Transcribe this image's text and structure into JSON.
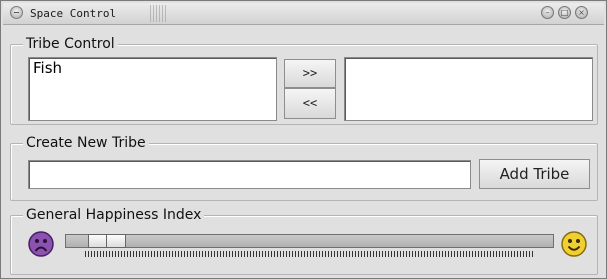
{
  "window": {
    "title": "Space Control"
  },
  "tribe_control": {
    "legend": "Tribe Control",
    "left_list": [
      "Fish"
    ],
    "right_list": [],
    "move_right_label": ">>",
    "move_left_label": "<<"
  },
  "create_tribe": {
    "legend": "Create New Tribe",
    "input_value": "",
    "add_button_label": "Add Tribe"
  },
  "happiness": {
    "legend": "General Happiness Index",
    "slider_value_percent": 5,
    "min_icon": "sad-face-icon",
    "max_icon": "happy-face-icon"
  },
  "colors": {
    "sad_face": "#7b3fa0",
    "happy_face": "#e0c020"
  }
}
